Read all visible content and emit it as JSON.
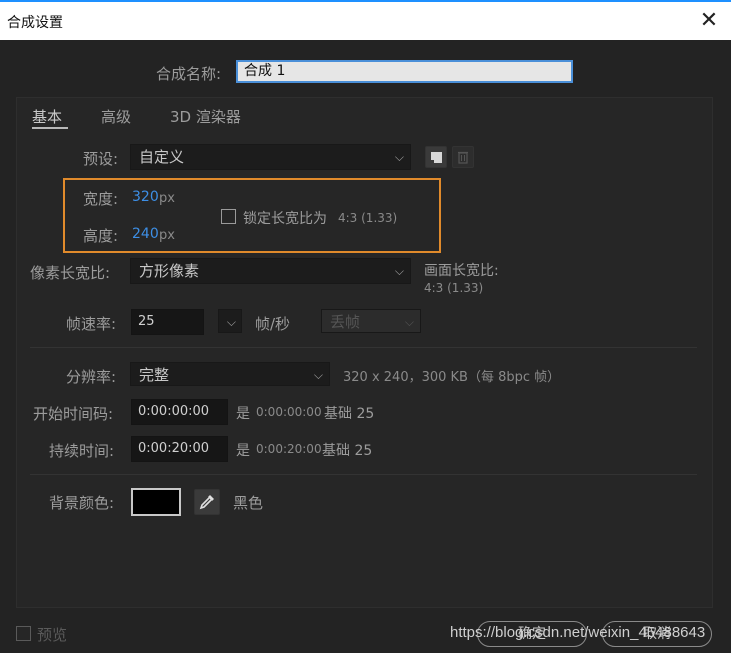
{
  "window": {
    "title": "合成设置",
    "close_glyph": "✕"
  },
  "comp_name": {
    "label": "合成名称:",
    "value": "合成 1"
  },
  "tabs": [
    {
      "label": "基本",
      "active": true
    },
    {
      "label": "高级",
      "active": false
    },
    {
      "label": "3D 渲染器",
      "active": false
    }
  ],
  "preset": {
    "label": "预设:",
    "value": "自定义"
  },
  "size": {
    "width_label": "宽度:",
    "width_value": "320",
    "width_unit": "px",
    "height_label": "高度:",
    "height_value": "240",
    "height_unit": "px",
    "lock_label": "锁定长宽比为",
    "lock_ratio": "4:3 (1.33)",
    "lock_checked": false
  },
  "pixel_aspect": {
    "label": "像素长宽比:",
    "value": "方形像素",
    "frame_aspect_label": "画面长宽比:",
    "frame_aspect_value": "4:3 (1.33)"
  },
  "frame_rate": {
    "label": "帧速率:",
    "value": "25",
    "unit": "帧/秒",
    "drop_frame": "丢帧"
  },
  "resolution": {
    "label": "分辨率:",
    "value": "完整",
    "info": "320 x 240，300 KB（每 8bpc 帧）"
  },
  "start_timecode": {
    "label": "开始时间码:",
    "value": "0:00:00:00",
    "is_label": "是",
    "is_value": "0:00:00:00",
    "base": "基础 25"
  },
  "duration": {
    "label": "持续时间:",
    "value": "0:00:20:00",
    "is_label": "是",
    "is_value": "0:00:20:00",
    "base": "基础 25"
  },
  "background": {
    "label": "背景颜色:",
    "color_name": "黑色",
    "color_hex": "#000000"
  },
  "footer": {
    "preview_label": "预览",
    "ok_label": "确定",
    "cancel_label": "取消",
    "watermark": "https://blog.csdn.net/weixin_45488643"
  },
  "colors": {
    "accent_blue": "#3d8fe6",
    "highlight_orange": "#e08a2b",
    "panel_bg": "#262626"
  },
  "icons": [
    "close-icon",
    "save-preset-icon",
    "delete-preset-icon",
    "eyedropper-icon",
    "chevron-down-icon"
  ]
}
